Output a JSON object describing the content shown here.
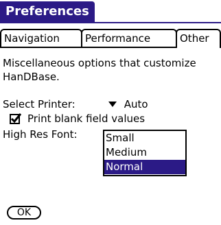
{
  "title": "Preferences",
  "tabs": [
    {
      "label": "Navigation",
      "selected": false
    },
    {
      "label": "Performance",
      "selected": false
    },
    {
      "label": "Other",
      "selected": true
    }
  ],
  "description": "Miscellaneous options that customize HanDBase.",
  "printer": {
    "label": "Select Printer:",
    "value": "Auto",
    "icon": "dropdown-arrow-icon"
  },
  "print_blank": {
    "label": "Print blank field values",
    "checked": true
  },
  "high_res_font": {
    "label": "High Res Font:",
    "options": [
      "Small",
      "Medium",
      "Normal"
    ],
    "selected": "Normal"
  },
  "ok_button": {
    "label": "OK"
  },
  "colors": {
    "accent": "#2b1a86",
    "background": "#ffffff",
    "text": "#000000"
  }
}
